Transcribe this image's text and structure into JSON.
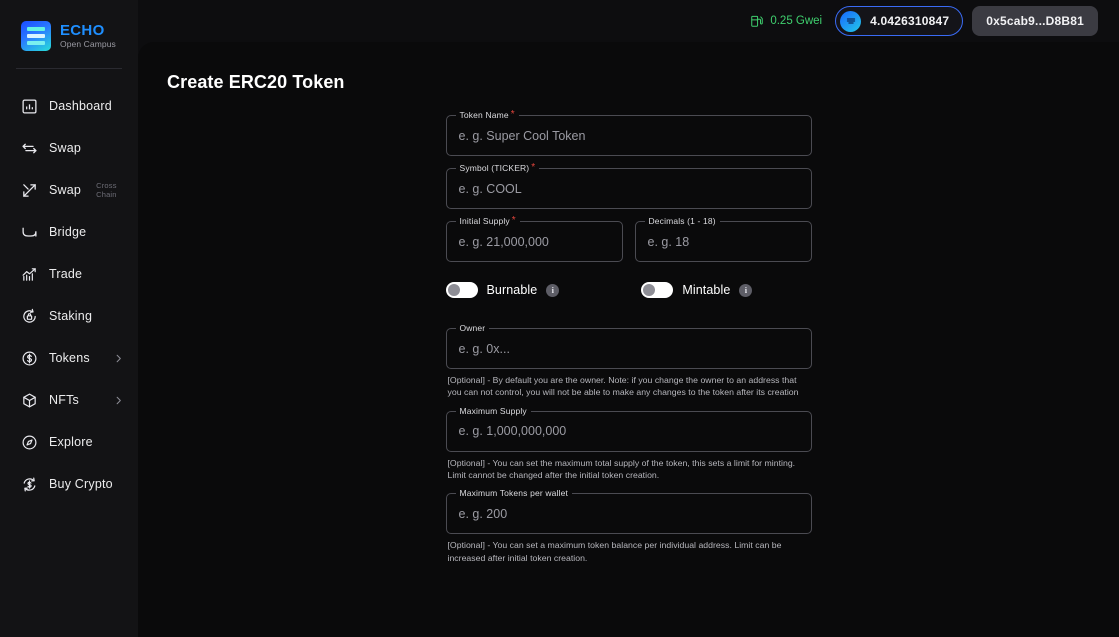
{
  "brand": {
    "name": "ECHO",
    "subtitle": "Open Campus",
    "logo_icon": "echo-bars-logo",
    "accent": "#1f8fff"
  },
  "sidebar": {
    "items": [
      {
        "label": "Dashboard",
        "icon": "dashboard-icon",
        "badge": "",
        "chevron": false
      },
      {
        "label": "Swap",
        "icon": "swap-arrows-icon",
        "badge": "",
        "chevron": false
      },
      {
        "label": "Swap",
        "icon": "cross-chain-swap-icon",
        "badge": "Cross Chain",
        "chevron": false
      },
      {
        "label": "Bridge",
        "icon": "bridge-icon",
        "badge": "",
        "chevron": false
      },
      {
        "label": "Trade",
        "icon": "trade-chart-icon",
        "badge": "",
        "chevron": false
      },
      {
        "label": "Staking",
        "icon": "staking-lock-icon",
        "badge": "",
        "chevron": false
      },
      {
        "label": "Tokens",
        "icon": "token-coin-icon",
        "badge": "",
        "chevron": true
      },
      {
        "label": "NFTs",
        "icon": "nft-box-icon",
        "badge": "",
        "chevron": true
      },
      {
        "label": "Explore",
        "icon": "explore-compass-icon",
        "badge": "",
        "chevron": false
      },
      {
        "label": "Buy Crypto",
        "icon": "buy-crypto-icon",
        "badge": "",
        "chevron": false
      }
    ]
  },
  "topbar": {
    "gas": {
      "value": "0.25 Gwei",
      "icon": "gas-pump-icon",
      "color": "#3fcf6e"
    },
    "balance": {
      "value": "4.0426310847",
      "icon": "edu-coin-icon",
      "border_color": "#3a6bf5"
    },
    "wallet": {
      "address": "0x5cab9...D8B81"
    }
  },
  "page": {
    "title": "Create ERC20 Token"
  },
  "form": {
    "token_name": {
      "label": "Token Name",
      "required": true,
      "placeholder": "e. g. Super Cool Token",
      "value": ""
    },
    "symbol": {
      "label": "Symbol (TICKER)",
      "required": true,
      "placeholder": "e. g. COOL",
      "value": ""
    },
    "initial_supply": {
      "label": "Initial Supply",
      "required": true,
      "placeholder": "e. g. 21,000,000",
      "value": ""
    },
    "decimals": {
      "label": "Decimals (1 - 18)",
      "required": false,
      "placeholder": "e. g. 18",
      "value": ""
    },
    "burnable": {
      "label": "Burnable",
      "enabled": false,
      "info_icon": "info-icon"
    },
    "mintable": {
      "label": "Mintable",
      "enabled": false,
      "info_icon": "info-icon"
    },
    "owner": {
      "label": "Owner",
      "required": false,
      "placeholder": "e. g. 0x...",
      "value": "",
      "helper": "[Optional] - By default you are the owner. Note: if you change the owner to an address that you can not control, you will not be able to make any changes to the token after its creation"
    },
    "maximum_supply": {
      "label": "Maximum Supply",
      "required": false,
      "placeholder": "e. g. 1,000,000,000",
      "value": "",
      "helper": "[Optional] - You can set the maximum total supply of the token, this sets a limit for minting. Limit cannot be changed after the initial token creation."
    },
    "maximum_tokens_per_wallet": {
      "label": "Maximum Tokens per wallet",
      "required": false,
      "placeholder": "e. g. 200",
      "value": "",
      "helper": "[Optional] - You can set a maximum token balance per individual address. Limit can be increased after initial token creation."
    }
  }
}
